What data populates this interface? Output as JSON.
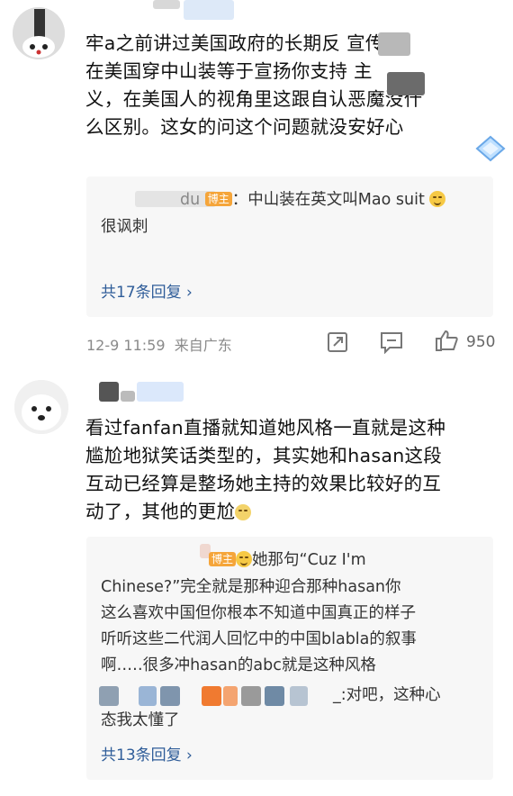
{
  "comments": [
    {
      "text_lines": [
        "牢a之前讲过美国政府的长期反      宣传下",
        "在美国穿中山装等于宣扬你支持      主",
        "义，在美国人的视角里这跟自认恶魔没什",
        "么区别。这女的问这个问题就没安好心"
      ],
      "author_visible": "",
      "reply": {
        "author_tag": "博主",
        "author_partial": "du",
        "text_line1": "：中山装在英文叫Mao suit",
        "text_line2": "很讽刺",
        "more_label": "共17条回复 ›"
      },
      "time": "12-9 11:59",
      "location": "来自广东",
      "likes": "950"
    },
    {
      "text_lines": [
        "看过fanfan直播就知道她风格一直就是这种",
        "尴尬地狱笑话类型的，其实她和hasan这段",
        "互动已经算是整场她主持的效果比较好的互",
        "动了，其他的更尬"
      ],
      "reply": {
        "author_tag": "博主",
        "text_line1": "她那句“Cuz I'm",
        "text_lines": [
          "Chinese?”完全就是那种迎合那种hasan你",
          "这么喜欢中国但你根本不知道中国真正的样子",
          "听听这些二代润人回忆中的中国blabla的叙事",
          "啊…‥很多冲hasan的abc就是这种风格"
        ],
        "sub_reply_line1": "_:对吧，这种心",
        "sub_reply_line2": "态我太懂了",
        "more_label": "共13条回复 ›"
      }
    }
  ],
  "colors": {
    "link": "#2f5d99",
    "tag": "#f5a53a",
    "meta": "#8a8a8a"
  }
}
